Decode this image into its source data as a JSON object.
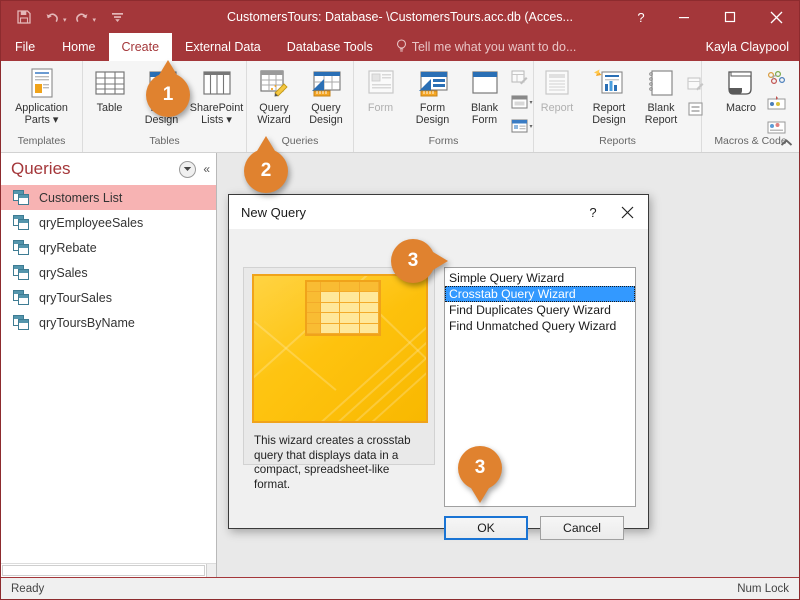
{
  "window": {
    "title": "CustomersTours: Database- \\CustomersTours.acc.db (Acces...",
    "help_icon": "?",
    "minimize_icon": "─",
    "maximize_icon": "☐",
    "close_icon": "✕"
  },
  "quick_access": {
    "save_icon": "💾",
    "undo_icon": "↶",
    "redo_icon": "↷",
    "customize_icon": "☰",
    "caret": "▾"
  },
  "tabs": [
    {
      "label": "File",
      "active": false
    },
    {
      "label": "Home",
      "active": false
    },
    {
      "label": "Create",
      "active": true
    },
    {
      "label": "External Data",
      "active": false
    },
    {
      "label": "Database Tools",
      "active": false
    }
  ],
  "tell_me": {
    "icon": "💡",
    "text": "Tell me what you want to do..."
  },
  "account_name": "Kayla Claypool",
  "ribbon": {
    "collapse_icon": "⌃",
    "groups": [
      {
        "name": "Templates",
        "buttons": [
          {
            "label": "Application\nParts ▾",
            "icon": "application-parts-icon",
            "disabled": false
          }
        ]
      },
      {
        "name": "Tables",
        "buttons": [
          {
            "label": "Table",
            "icon": "table-icon",
            "disabled": false
          },
          {
            "label": "Table\nDesign",
            "icon": "table-design-icon",
            "disabled": false
          },
          {
            "label": "SharePoint\nLists ▾",
            "icon": "sharepoint-lists-icon",
            "disabled": false
          }
        ]
      },
      {
        "name": "Queries",
        "buttons": [
          {
            "label": "Query\nWizard",
            "icon": "query-wizard-icon",
            "disabled": false
          },
          {
            "label": "Query\nDesign",
            "icon": "query-design-icon",
            "disabled": false
          }
        ]
      },
      {
        "name": "Forms",
        "buttons": [
          {
            "label": "Form",
            "icon": "form-icon",
            "disabled": true
          },
          {
            "label": "Form\nDesign",
            "icon": "form-design-icon",
            "disabled": false
          },
          {
            "label": "Blank\nForm",
            "icon": "blank-form-icon",
            "disabled": false
          }
        ]
      },
      {
        "name": "Reports",
        "buttons": [
          {
            "label": "Report",
            "icon": "report-icon",
            "disabled": true
          },
          {
            "label": "Report\nDesign",
            "icon": "report-design-icon",
            "disabled": false
          },
          {
            "label": "Blank\nReport",
            "icon": "blank-report-icon",
            "disabled": false
          }
        ]
      },
      {
        "name": "Macros & Code",
        "buttons": [
          {
            "label": "Macro",
            "icon": "macro-icon",
            "disabled": false
          }
        ]
      }
    ]
  },
  "navigation_pane": {
    "title": "Queries",
    "dropdown_icon": "▾",
    "collapse_icon": "«",
    "items": [
      {
        "label": "Customers List",
        "selected": true
      },
      {
        "label": "qryEmployeeSales",
        "selected": false
      },
      {
        "label": "qryRebate",
        "selected": false
      },
      {
        "label": "qrySales",
        "selected": false
      },
      {
        "label": "qryTourSales",
        "selected": false
      },
      {
        "label": "qryToursByName",
        "selected": false
      }
    ]
  },
  "dialog": {
    "title": "New Query",
    "help_icon": "?",
    "close_icon": "✕",
    "description": "This wizard creates a crosstab query that displays data in a compact, spreadsheet-like format.",
    "wizards": [
      {
        "label": "Simple Query Wizard",
        "selected": false
      },
      {
        "label": "Crosstab Query Wizard",
        "selected": true
      },
      {
        "label": "Find Duplicates Query Wizard",
        "selected": false
      },
      {
        "label": "Find Unmatched Query Wizard",
        "selected": false
      }
    ],
    "ok_label": "OK",
    "cancel_label": "Cancel"
  },
  "status_bar": {
    "left": "Ready",
    "right": "Num Lock"
  },
  "callouts": [
    {
      "number": "1",
      "direction": "up"
    },
    {
      "number": "2",
      "direction": "up"
    },
    {
      "number": "3",
      "direction": "right"
    },
    {
      "number": "3",
      "direction": "down"
    }
  ],
  "colors": {
    "brand_red": "#a4373a",
    "callout_orange": "#e0822f",
    "selection_blue": "#3399ff",
    "nav_selected_pink": "#f7b3b3",
    "preview_gold": "#fec30f"
  }
}
